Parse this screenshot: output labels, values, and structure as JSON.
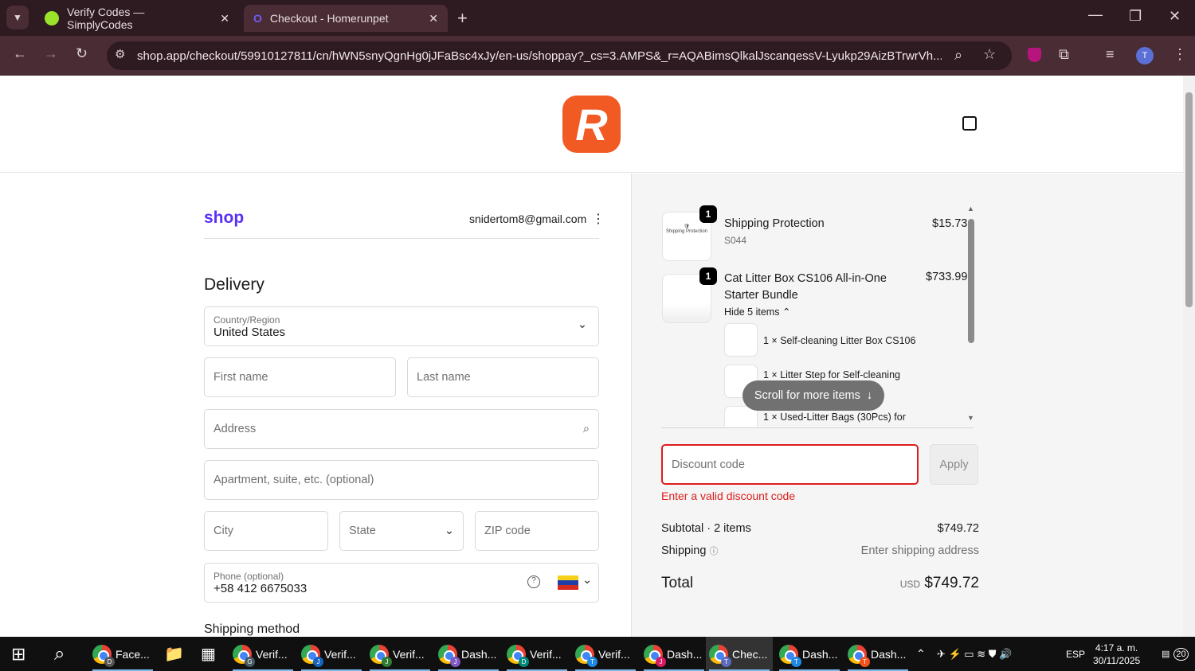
{
  "browser": {
    "tabs": [
      {
        "title": "Verify Codes — SimplyCodes",
        "active": false
      },
      {
        "title": "Checkout - Homerunpet",
        "active": true
      }
    ],
    "url": "shop.app/checkout/59910127811/cn/hWN5snyQgnHg0jJFaBsc4xJy/en-us/shoppay?_cs=3.AMPS&_r=AQABimsQlkalJscanqessV-Lyukp29AizBTrwrVh...",
    "profile_initial": "T"
  },
  "header": {
    "logo_letter": "R",
    "brand_color": "#f25a24"
  },
  "account": {
    "shop_logo": "shop",
    "email": "snidertom8@gmail.com"
  },
  "delivery": {
    "title": "Delivery",
    "country_label": "Country/Region",
    "country_value": "United States",
    "first_name_placeholder": "First name",
    "last_name_placeholder": "Last name",
    "address_placeholder": "Address",
    "apartment_placeholder": "Apartment, suite, etc. (optional)",
    "city_placeholder": "City",
    "state_placeholder": "State",
    "zip_placeholder": "ZIP code",
    "phone_label": "Phone (optional)",
    "phone_value": "+58 412 6675033"
  },
  "shipping_method_title": "Shipping method",
  "cart": {
    "items": [
      {
        "qty": "1",
        "name": "Shipping Protection",
        "sku": "S044",
        "price": "$15.73",
        "thumb_text": "Shipping Protection"
      },
      {
        "qty": "1",
        "name": "Cat Litter Box CS106 All-in-One Starter Bundle",
        "price": "$733.99",
        "toggle": "Hide 5 items",
        "components": [
          "1 × Self-cleaning Litter Box CS106",
          "1 × Litter Step for Self-cleaning",
          "1 × Used-Litter Bags (30Pcs) for"
        ]
      }
    ],
    "scroll_hint": "Scroll for more items"
  },
  "discount": {
    "placeholder": "Discount code",
    "apply": "Apply",
    "error": "Enter a valid discount code"
  },
  "summary": {
    "subtotal_label": "Subtotal · 2 items",
    "subtotal": "$749.72",
    "shipping_label": "Shipping",
    "shipping_value": "Enter shipping address",
    "total_label": "Total",
    "currency": "USD",
    "total": "$749.72"
  },
  "taskbar": {
    "apps": [
      {
        "label": "Face...",
        "badge": "D",
        "color": "#555"
      },
      {
        "label": "Verif...",
        "badge": "G",
        "color": "#455a64"
      },
      {
        "label": "Verif...",
        "badge": "J",
        "color": "#1565c0"
      },
      {
        "label": "Verif...",
        "badge": "J",
        "color": "#2e7d32"
      },
      {
        "label": "Dash...",
        "badge": "J",
        "color": "#7e57c2"
      },
      {
        "label": "Verif...",
        "badge": "D",
        "color": "#00897b"
      },
      {
        "label": "Verif...",
        "badge": "T",
        "color": "#1e88e5"
      },
      {
        "label": "Dash...",
        "badge": "J",
        "color": "#d81b60"
      },
      {
        "label": "Chec...",
        "badge": "T",
        "color": "#5c6bc0"
      },
      {
        "label": "Dash...",
        "badge": "T",
        "color": "#1e88e5"
      },
      {
        "label": "Dash...",
        "badge": "T",
        "color": "#f4511e"
      }
    ],
    "language": "ESP",
    "time": "4:17 a. m.",
    "date": "30/11/2025",
    "notifications": "20"
  }
}
